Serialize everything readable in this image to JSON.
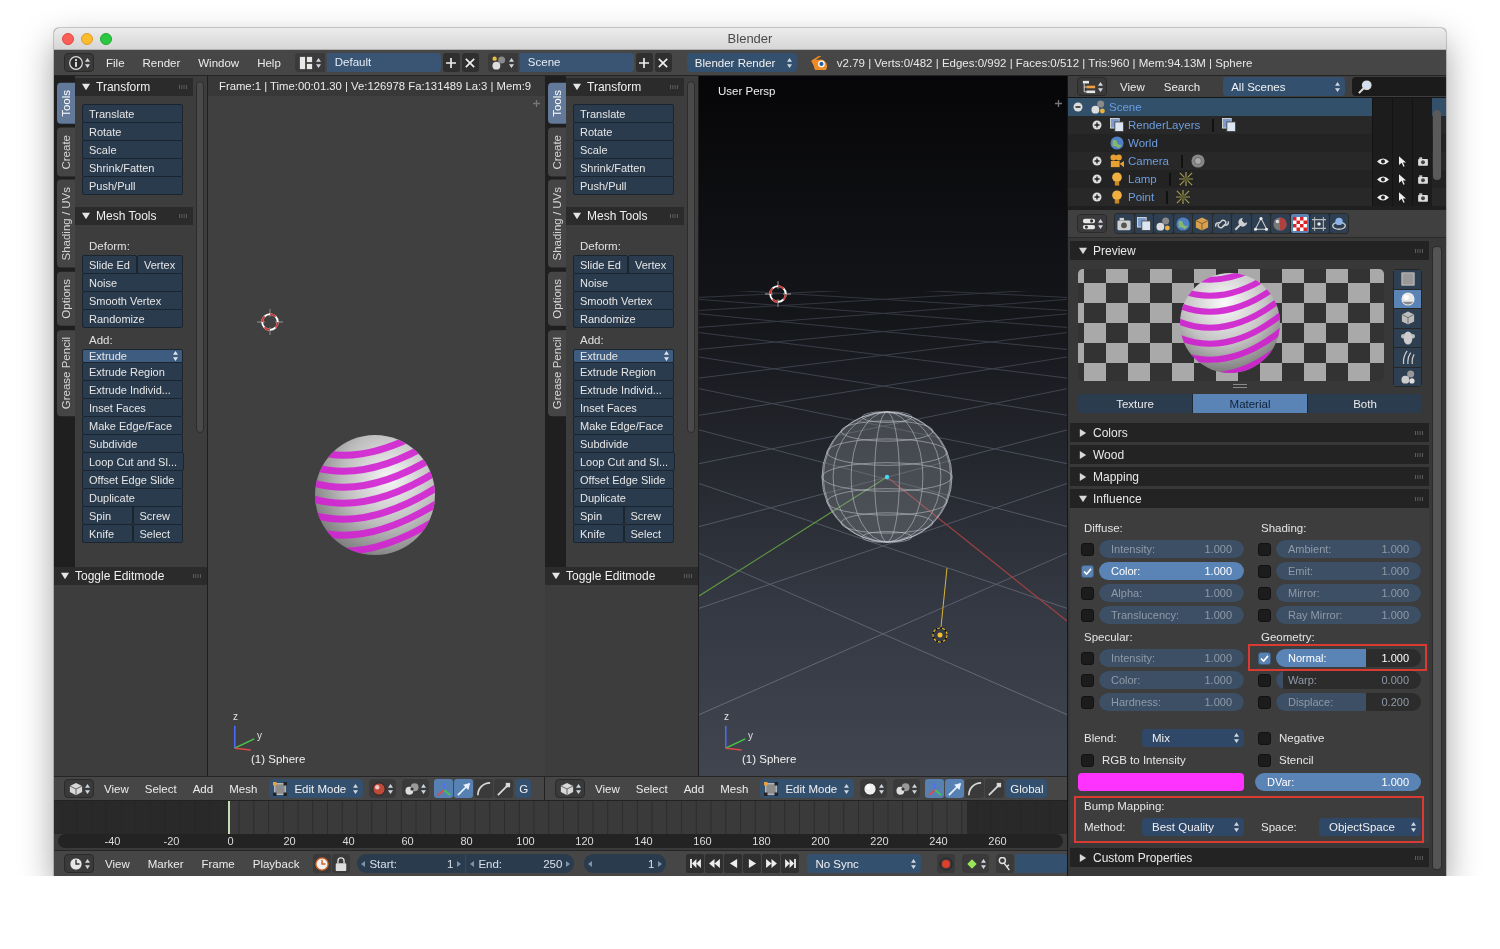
{
  "window": {
    "title": "Blender"
  },
  "info_header": {
    "menus": [
      "File",
      "Render",
      "Window",
      "Help"
    ],
    "layout": "Default",
    "scene": "Scene",
    "engine": "Blender Render",
    "stats": "v2.79 | Verts:0/482 | Edges:0/992 | Faces:0/512 | Tris:960 | Mem:94.13M | Sphere"
  },
  "views": [
    {
      "kind": "rendered",
      "tabs": [
        {
          "label": "Tools",
          "selected": true
        },
        {
          "label": "Create",
          "selected": false
        },
        {
          "label": "Shading / UVs",
          "selected": false
        },
        {
          "label": "Options",
          "selected": false
        },
        {
          "label": "Grease Pencil",
          "selected": false
        }
      ],
      "panels": [
        {
          "title": "Transform",
          "expanded": true,
          "items": [
            {
              "kind": "button",
              "texts": [
                "Translate"
              ]
            },
            {
              "kind": "button",
              "texts": [
                "Rotate"
              ]
            },
            {
              "kind": "button",
              "texts": [
                "Scale"
              ]
            },
            {
              "kind": "button",
              "texts": [
                "Shrink/Fatten"
              ]
            },
            {
              "kind": "button",
              "texts": [
                "Push/Pull"
              ]
            }
          ]
        },
        {
          "title": "Mesh Tools",
          "expanded": true,
          "items": [
            {
              "kind": "label",
              "texts": [
                "Deform:"
              ]
            },
            {
              "kind": "button",
              "texts": [
                "Slide Ed",
                "Vertex"
              ]
            },
            {
              "kind": "button",
              "texts": [
                "Noise"
              ]
            },
            {
              "kind": "button",
              "texts": [
                "Smooth Vertex"
              ]
            },
            {
              "kind": "button",
              "texts": [
                "Randomize"
              ]
            },
            {
              "kind": "label",
              "texts": [
                "Add:"
              ]
            },
            {
              "kind": "dropdown",
              "texts": [
                "Extrude"
              ]
            },
            {
              "kind": "button",
              "texts": [
                "Extrude Region"
              ]
            },
            {
              "kind": "button",
              "texts": [
                "Extrude Individ..."
              ]
            },
            {
              "kind": "button",
              "texts": [
                "Inset Faces"
              ]
            },
            {
              "kind": "button",
              "texts": [
                "Make Edge/Face"
              ]
            },
            {
              "kind": "button",
              "texts": [
                "Subdivide"
              ]
            },
            {
              "kind": "button",
              "texts": [
                "Loop Cut and Sl..."
              ]
            },
            {
              "kind": "button",
              "texts": [
                "Offset Edge Slide"
              ]
            },
            {
              "kind": "button",
              "texts": [
                "Duplicate"
              ]
            },
            {
              "kind": "button",
              "texts": [
                "Spin",
                "Screw"
              ]
            },
            {
              "kind": "button",
              "texts": [
                "Knife",
                "Select"
              ]
            }
          ]
        }
      ],
      "redo_panel": {
        "title": "Toggle Editmode",
        "expanded": true
      },
      "overlay": "Frame:1 | Time:00:01.30 | Ve:126978 Fa:131489 La:3 | Mem:9",
      "axis_labels": [
        "z",
        "y"
      ],
      "object_label": "(1) Sphere",
      "header": {
        "menus": [
          "View",
          "Select",
          "Add",
          "Mesh"
        ],
        "mode": "Edit Mode",
        "manipulators": [
          {
            "kind": "widget",
            "selected": true
          },
          {
            "kind": "translate",
            "selected": true
          },
          {
            "kind": "rotate",
            "selected": false
          },
          {
            "kind": "scale",
            "selected": false
          }
        ],
        "orientation": "G"
      }
    },
    {
      "kind": "solid",
      "tabs": [
        {
          "label": "Tools",
          "selected": true
        },
        {
          "label": "Create",
          "selected": false
        },
        {
          "label": "Shading / UVs",
          "selected": false
        },
        {
          "label": "Options",
          "selected": false
        },
        {
          "label": "Grease Pencil",
          "selected": false
        }
      ],
      "panels": [
        {
          "title": "Transform",
          "expanded": true,
          "items": [
            {
              "kind": "button",
              "texts": [
                "Translate"
              ]
            },
            {
              "kind": "button",
              "texts": [
                "Rotate"
              ]
            },
            {
              "kind": "button",
              "texts": [
                "Scale"
              ]
            },
            {
              "kind": "button",
              "texts": [
                "Shrink/Fatten"
              ]
            },
            {
              "kind": "button",
              "texts": [
                "Push/Pull"
              ]
            }
          ]
        },
        {
          "title": "Mesh Tools",
          "expanded": true,
          "items": [
            {
              "kind": "label",
              "texts": [
                "Deform:"
              ]
            },
            {
              "kind": "button",
              "texts": [
                "Slide Ed",
                "Vertex"
              ]
            },
            {
              "kind": "button",
              "texts": [
                "Noise"
              ]
            },
            {
              "kind": "button",
              "texts": [
                "Smooth Vertex"
              ]
            },
            {
              "kind": "button",
              "texts": [
                "Randomize"
              ]
            },
            {
              "kind": "label",
              "texts": [
                "Add:"
              ]
            },
            {
              "kind": "dropdown",
              "texts": [
                "Extrude"
              ]
            },
            {
              "kind": "button",
              "texts": [
                "Extrude Region"
              ]
            },
            {
              "kind": "button",
              "texts": [
                "Extrude Individ..."
              ]
            },
            {
              "kind": "button",
              "texts": [
                "Inset Faces"
              ]
            },
            {
              "kind": "button",
              "texts": [
                "Make Edge/Face"
              ]
            },
            {
              "kind": "button",
              "texts": [
                "Subdivide"
              ]
            },
            {
              "kind": "button",
              "texts": [
                "Loop Cut and Sl..."
              ]
            },
            {
              "kind": "button",
              "texts": [
                "Offset Edge Slide"
              ]
            },
            {
              "kind": "button",
              "texts": [
                "Duplicate"
              ]
            },
            {
              "kind": "button",
              "texts": [
                "Spin",
                "Screw"
              ]
            },
            {
              "kind": "button",
              "texts": [
                "Knife",
                "Select"
              ]
            }
          ]
        }
      ],
      "redo_panel": {
        "title": "Toggle Editmode",
        "expanded": true
      },
      "overlay": "User Persp",
      "axis_labels": [
        "z",
        "y"
      ],
      "object_label": "(1) Sphere",
      "header": {
        "menus": [
          "View",
          "Select",
          "Add",
          "Mesh"
        ],
        "mode": "Edit Mode",
        "manipulators": [
          {
            "kind": "widget",
            "selected": true
          },
          {
            "kind": "translate",
            "selected": true
          },
          {
            "kind": "rotate",
            "selected": false
          },
          {
            "kind": "scale",
            "selected": false
          }
        ],
        "orientation": "Global"
      }
    }
  ],
  "timeline": {
    "ruler": [
      "-40",
      "-20",
      "0",
      "20",
      "40",
      "60",
      "80",
      "100",
      "120",
      "140",
      "160",
      "180",
      "200",
      "220",
      "240",
      "260"
    ],
    "header": {
      "menus": [
        "View",
        "Marker",
        "Frame",
        "Playback"
      ],
      "start": {
        "label": "Start:",
        "value": "1"
      },
      "end": {
        "label": "End:",
        "value": "250"
      },
      "frame": "1",
      "sync": "No Sync"
    }
  },
  "outliner": {
    "menus": [
      "View",
      "Search"
    ],
    "filter": "All Scenes",
    "tree": [
      {
        "name": "Scene",
        "kind": "scene",
        "expanded": true,
        "selected": true,
        "children": [
          {
            "name": "RenderLayers",
            "kind": "render_layers",
            "expanded": false,
            "selected": false
          },
          {
            "name": "World",
            "kind": "world",
            "selected": false
          },
          {
            "name": "Camera",
            "kind": "camera",
            "expanded": false,
            "selected": false
          },
          {
            "name": "Lamp",
            "kind": "lamp",
            "expanded": false,
            "selected": false
          },
          {
            "name": "Point",
            "kind": "lamp",
            "expanded": false,
            "selected": false
          }
        ]
      }
    ]
  },
  "properties": {
    "context_tabs": [
      {
        "kind": "render",
        "selected": false
      },
      {
        "kind": "render_layers",
        "selected": false
      },
      {
        "kind": "scene",
        "selected": false
      },
      {
        "kind": "world",
        "selected": false
      },
      {
        "kind": "object",
        "selected": false
      },
      {
        "kind": "constraints",
        "selected": false
      },
      {
        "kind": "modifiers",
        "selected": false
      },
      {
        "kind": "data",
        "selected": false
      },
      {
        "kind": "material",
        "selected": false
      },
      {
        "kind": "texture",
        "selected": true
      },
      {
        "kind": "particles",
        "selected": false
      },
      {
        "kind": "physics",
        "selected": false
      }
    ],
    "preview": {
      "title": "Preview",
      "expanded": true,
      "shapes": [
        {
          "kind": "plane",
          "selected": false
        },
        {
          "kind": "sphere",
          "selected": true
        },
        {
          "kind": "cube",
          "selected": false
        },
        {
          "kind": "monkey",
          "selected": false
        },
        {
          "kind": "hair",
          "selected": false
        },
        {
          "kind": "sky",
          "selected": false
        }
      ],
      "modes": [
        {
          "label": "Texture",
          "selected": false
        },
        {
          "label": "Material",
          "selected": true
        },
        {
          "label": "Both",
          "selected": false
        }
      ]
    },
    "panels": [
      {
        "title": "Colors",
        "expanded": false
      },
      {
        "title": "Wood",
        "expanded": false
      },
      {
        "title": "Mapping",
        "expanded": false
      },
      {
        "title": "Influence",
        "expanded": true
      }
    ],
    "influence": {
      "groups": [
        {
          "title": "Diffuse:",
          "factors": [
            {
              "label": "Intensity:",
              "value": "1.000",
              "checked": false,
              "level": 1,
              "highlighted": false
            },
            {
              "label": "Color:",
              "value": "1.000",
              "checked": true,
              "level": 1,
              "highlighted": false
            },
            {
              "label": "Alpha:",
              "value": "1.000",
              "checked": false,
              "level": 1,
              "highlighted": false
            },
            {
              "label": "Translucency:",
              "value": "1.000",
              "checked": false,
              "level": 1,
              "highlighted": false
            }
          ]
        },
        {
          "title": "Shading:",
          "factors": [
            {
              "label": "Ambient:",
              "value": "1.000",
              "checked": false,
              "level": 1,
              "highlighted": false
            },
            {
              "label": "Emit:",
              "value": "1.000",
              "checked": false,
              "level": 1,
              "highlighted": false
            },
            {
              "label": "Mirror:",
              "value": "1.000",
              "checked": false,
              "level": 1,
              "highlighted": false
            },
            {
              "label": "Ray Mirror:",
              "value": "1.000",
              "checked": false,
              "level": 1,
              "highlighted": false
            }
          ]
        },
        {
          "title": "Specular:",
          "factors": [
            {
              "label": "Intensity:",
              "value": "1.000",
              "checked": false,
              "level": 1,
              "highlighted": false
            },
            {
              "label": "Color:",
              "value": "1.000",
              "checked": false,
              "level": 1,
              "highlighted": false
            },
            {
              "label": "Hardness:",
              "value": "1.000",
              "checked": false,
              "level": 1,
              "highlighted": false
            }
          ]
        },
        {
          "title": "Geometry:",
          "factors": [
            {
              "label": "Normal:",
              "value": "1.000",
              "checked": true,
              "level": 0.62,
              "highlighted": true
            },
            {
              "label": "Warp:",
              "value": "0.000",
              "checked": false,
              "level": 0.05,
              "highlighted": false
            },
            {
              "label": "Displace:",
              "value": "0.200",
              "checked": false,
              "level": 0.62,
              "highlighted": false
            }
          ]
        }
      ],
      "blend": {
        "label": "Blend:",
        "value": "Mix"
      },
      "options": [
        {
          "label": "Negative",
          "checked": false
        },
        {
          "label": "RGB to Intensity",
          "checked": false
        },
        {
          "label": "Stencil",
          "checked": false
        }
      ],
      "color": "#ff33ff",
      "dvar": {
        "label": "DVar:",
        "value": "1.000",
        "level": 1
      },
      "bump": {
        "title": "Bump Mapping:",
        "highlighted": true,
        "method": {
          "label": "Method:",
          "value": "Best Quality"
        },
        "space": {
          "label": "Space:",
          "value": "ObjectSpace"
        }
      }
    },
    "footer_panel": {
      "title": "Custom Properties",
      "expanded": false
    }
  }
}
